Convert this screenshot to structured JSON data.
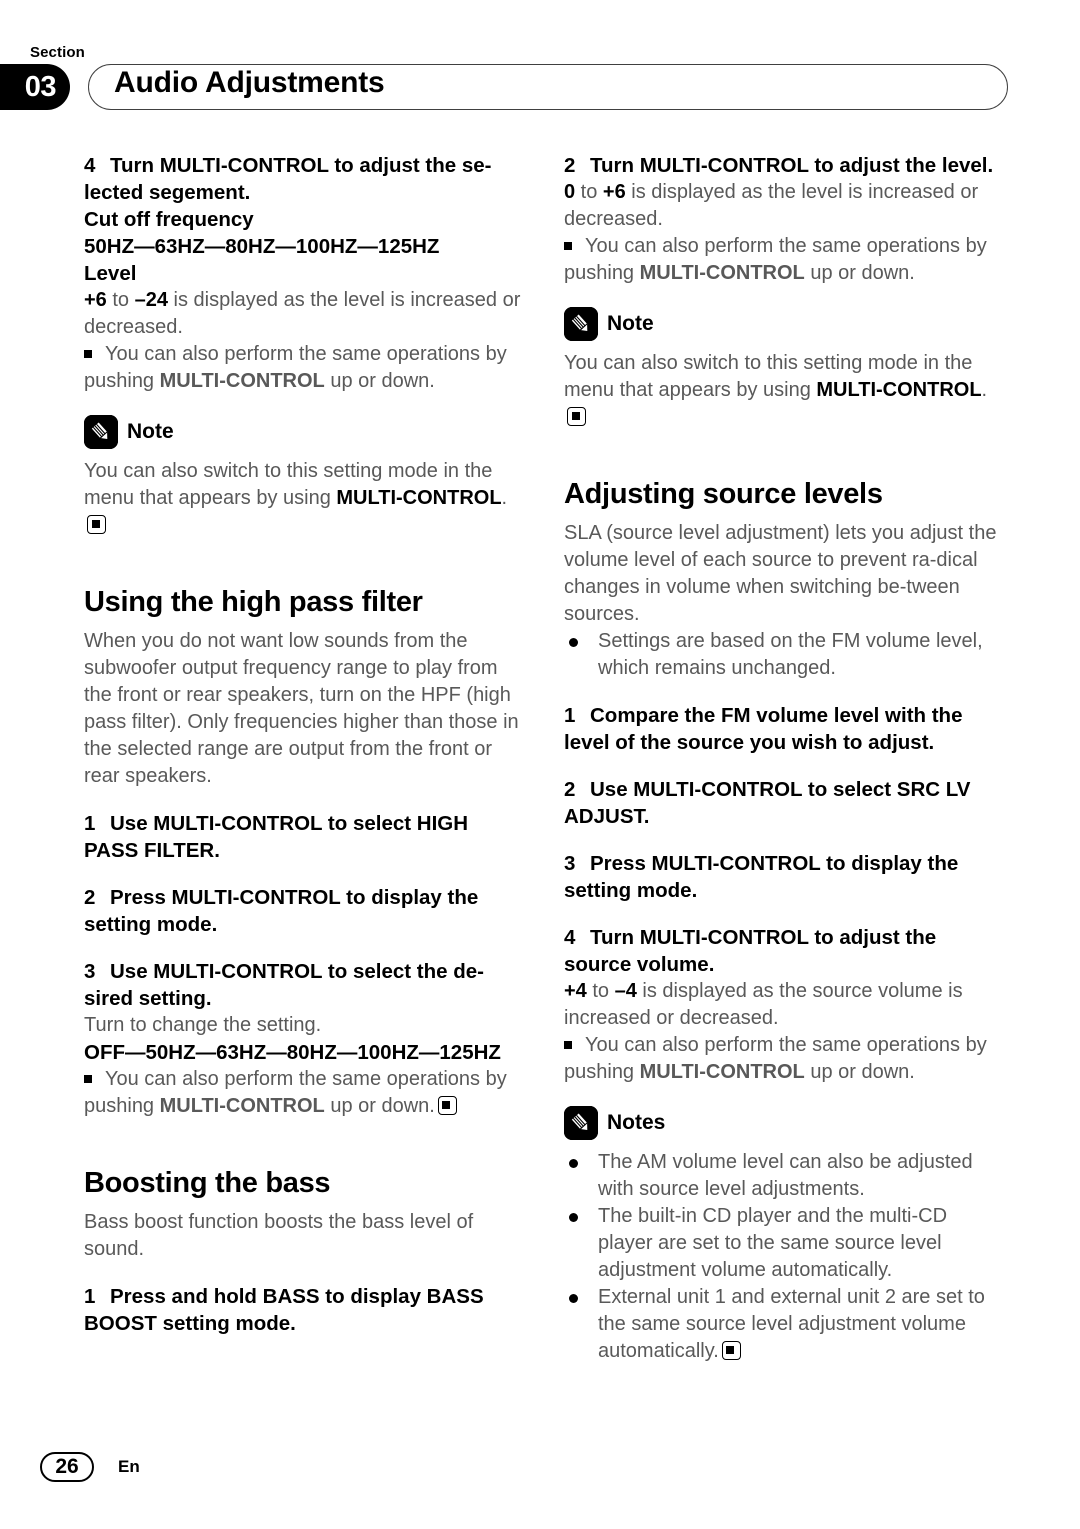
{
  "header": {
    "section_word": "Section",
    "section_number": "03",
    "title": "Audio Adjustments"
  },
  "left_column": {
    "step4": {
      "num": "4",
      "text": "Turn MULTI-CONTROL to adjust the se-lected segement."
    },
    "cut_off_heading": "Cut off frequency",
    "cut_off_values": "50HZ—63HZ—80HZ—100HZ—125HZ",
    "level_heading": "Level",
    "level_range_a": "+6",
    "level_range_to": " to ",
    "level_range_b": "–24",
    "level_range_tail": " is displayed as the level is increased or decreased.",
    "bullet_push_a": "You can also perform the same operations by pushing ",
    "bullet_push_b": "MULTI-CONTROL",
    "bullet_push_c": " up or down.",
    "note_label": "Note",
    "note_text": "You can also switch to this setting mode in the menu that appears by using ",
    "note_bold": "MULTI-CONTROL",
    "note_period": ".",
    "hpf_heading": "Using the high pass filter",
    "hpf_body": "When you do not want low sounds from the subwoofer output frequency range to play from the front or rear speakers, turn on the HPF (high pass filter). Only frequencies higher than those in the selected range are output from the front or rear speakers.",
    "hpf_step1": {
      "num": "1",
      "text": "Use MULTI-CONTROL to select HIGH PASS FILTER."
    },
    "hpf_step2": {
      "num": "2",
      "text": "Press MULTI-CONTROL to display the setting mode."
    },
    "hpf_step3": {
      "num": "3",
      "text": "Use MULTI-CONTROL to select the de-sired setting."
    },
    "hpf_step3_note": "Turn to change the setting.",
    "hpf_values": "OFF—50HZ—63HZ—80HZ—100HZ—125HZ",
    "bass_heading": "Boosting the bass",
    "bass_body": "Bass boost function boosts the bass level of sound.",
    "bass_step1": {
      "num": "1",
      "text": "Press and hold BASS to display BASS BOOST setting mode."
    }
  },
  "right_column": {
    "step2": {
      "num": "2",
      "text": "Turn MULTI-CONTROL to adjust the level."
    },
    "level_range_a": "0",
    "level_range_to": " to ",
    "level_range_b": "+6",
    "level_range_tail": " is displayed as the level is increased or decreased.",
    "bullet_push_a": "You can also perform the same operations by pushing ",
    "bullet_push_b": "MULTI-CONTROL",
    "bullet_push_c": " up or down.",
    "note_label": "Note",
    "note_text": "You can also switch to this setting mode in the menu that appears by using ",
    "note_bold": "MULTI-CONTROL",
    "note_period": ".",
    "sla_heading": "Adjusting source levels",
    "sla_body": "SLA (source level adjustment) lets you adjust the volume level of each source to prevent ra-dical changes in volume when switching be-tween sources.",
    "sla_bullet": "Settings are based on the FM volume level, which remains unchanged.",
    "sla_step1": {
      "num": "1",
      "text": "Compare the FM volume level with the level of the source you wish to adjust."
    },
    "sla_step2": {
      "num": "2",
      "text": "Use MULTI-CONTROL to select SRC LV ADJUST."
    },
    "sla_step3": {
      "num": "3",
      "text": "Press MULTI-CONTROL to display the setting mode."
    },
    "sla_step4": {
      "num": "4",
      "text": "Turn MULTI-CONTROL to adjust the source volume."
    },
    "src_range_a": "+4",
    "src_range_to": " to ",
    "src_range_b": "–4",
    "src_range_tail": " is displayed as the source volume is increased or decreased.",
    "notes_label": "Notes",
    "notes_items": [
      "The AM volume level can also be adjusted with source level adjustments.",
      "The built-in CD player and the multi-CD player are set to the same source level adjustment volume automatically.",
      "External unit 1 and external unit 2 are set to the same source level adjustment volume automatically."
    ]
  },
  "footer": {
    "page_number": "26",
    "language": "En"
  },
  "icons": {
    "note": "pencil-icon",
    "end_marker": "end-of-section-icon"
  },
  "colors": {
    "body_text": "#595959",
    "emphasis_text": "#000000",
    "badge_bg": "#000000",
    "pill_border": "#404040"
  }
}
